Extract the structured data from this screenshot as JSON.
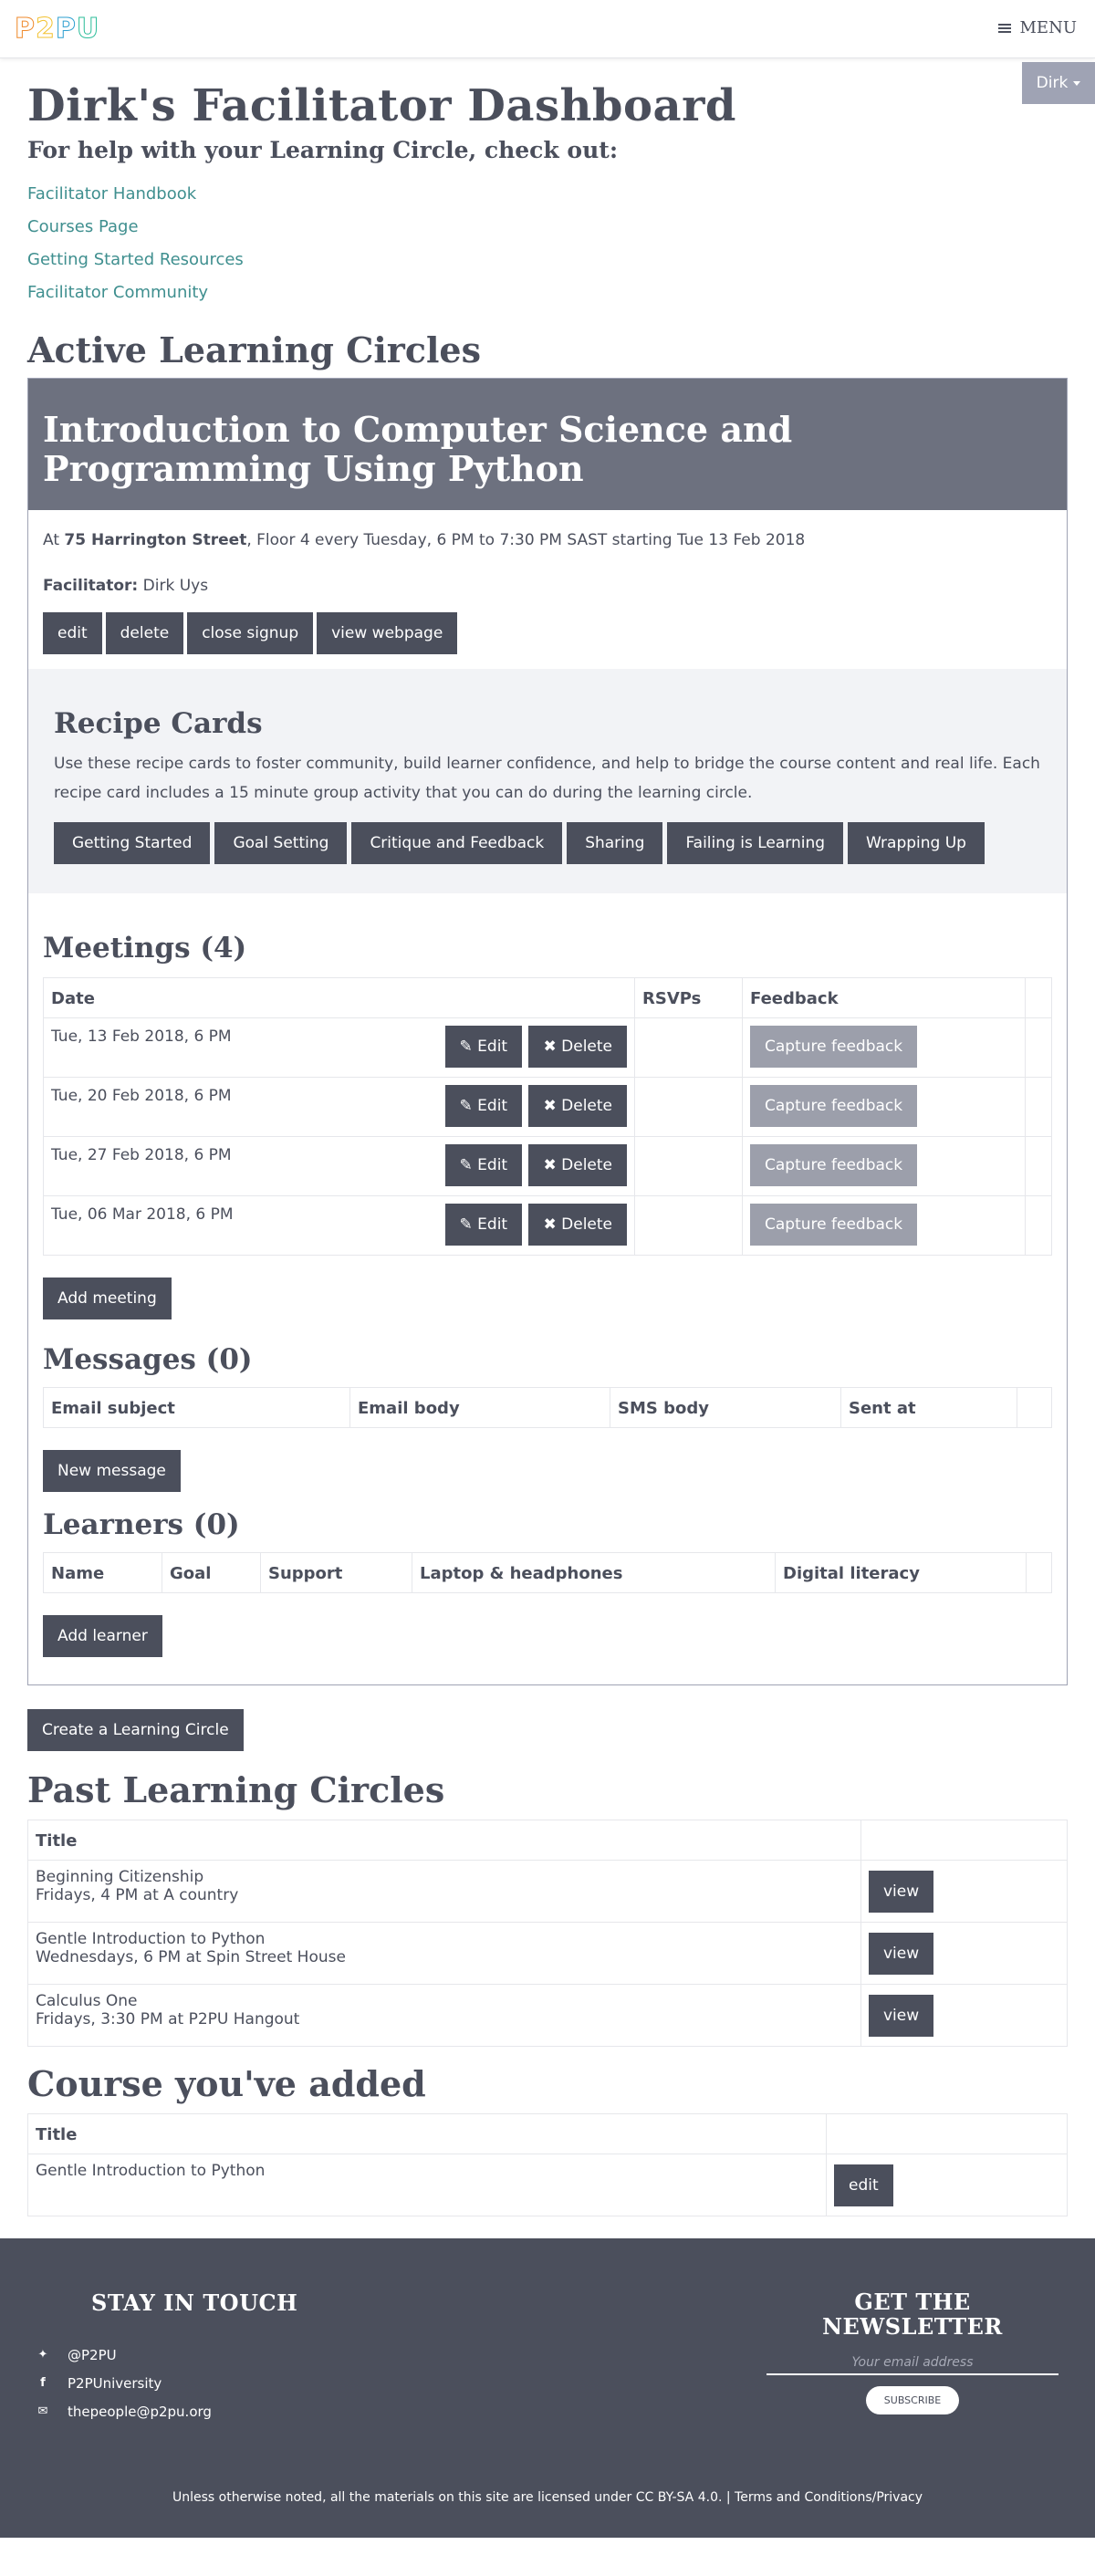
{
  "nav": {
    "logo": [
      "P",
      "2",
      "P",
      "U"
    ],
    "menu_label": "MENU",
    "user_label": "Dirk"
  },
  "page": {
    "title": "Dirk's Facilitator Dashboard",
    "help_heading": "For help with your Learning Circle, check out:",
    "help_links": [
      "Facilitator Handbook",
      "Courses Page",
      "Getting Started Resources",
      "Facilitator Community"
    ],
    "active_heading": "Active Learning Circles"
  },
  "circle": {
    "title": "Introduction to Computer Science and Programming Using Python",
    "at_prefix": "At ",
    "venue": "75 Harrington Street",
    "schedule": ", Floor 4 every Tuesday, 6 PM to 7:30 PM SAST starting Tue 13 Feb 2018",
    "facilitator_label": "Facilitator:",
    "facilitator_name": "Dirk Uys",
    "buttons": [
      "edit",
      "delete",
      "close signup",
      "view webpage"
    ]
  },
  "recipe": {
    "heading": "Recipe Cards",
    "description": "Use these recipe cards to foster community, build learner confidence, and help to bridge the course content and real life. Each recipe card includes a 15 minute group activity that you can do during the learning circle.",
    "cards": [
      "Getting Started",
      "Goal Setting",
      "Critique and Feedback",
      "Sharing",
      "Failing is Learning",
      "Wrapping Up"
    ]
  },
  "meetings": {
    "heading": "Meetings (4)",
    "columns": [
      "Date",
      "RSVPs",
      "Feedback"
    ],
    "rows": [
      {
        "date": "Tue, 13 Feb 2018, 6 PM"
      },
      {
        "date": "Tue, 20 Feb 2018, 6 PM"
      },
      {
        "date": "Tue, 27 Feb 2018, 6 PM"
      },
      {
        "date": "Tue, 06 Mar 2018, 6 PM"
      }
    ],
    "edit_label": "Edit",
    "delete_label": "Delete",
    "feedback_label": "Capture feedback",
    "add_label": "Add meeting"
  },
  "messages": {
    "heading": "Messages (0)",
    "columns": [
      "Email subject",
      "Email body",
      "SMS body",
      "Sent at"
    ],
    "new_label": "New message"
  },
  "learners": {
    "heading": "Learners (0)",
    "columns": [
      "Name",
      "Goal",
      "Support",
      "Laptop & headphones",
      "Digital literacy"
    ],
    "add_label": "Add learner"
  },
  "create_label": "Create a Learning Circle",
  "past": {
    "heading": "Past Learning Circles",
    "title_col": "Title",
    "rows": [
      {
        "title": "Beginning Citizenship",
        "detail": "Fridays, 4 PM at A country"
      },
      {
        "title": "Gentle Introduction to Python",
        "detail": "Wednesdays, 6 PM at Spin Street House"
      },
      {
        "title": "Calculus One",
        "detail": "Fridays, 3:30 PM at P2PU Hangout"
      }
    ],
    "view_label": "view"
  },
  "courses": {
    "heading": "Course you've added",
    "title_col": "Title",
    "rows": [
      {
        "title": "Gentle Introduction to Python"
      }
    ],
    "edit_label": "edit"
  },
  "footer": {
    "stay_heading": "STAY IN TOUCH",
    "twitter": "@P2PU",
    "facebook": "P2PUniversity",
    "email": "thepeople@p2pu.org",
    "newsletter_heading": "GET THE NEWSLETTER",
    "email_placeholder": "Your email address",
    "subscribe_label": "SUBSCRIBE",
    "license": "Unless otherwise noted, all the materials on this site are licensed under CC BY-SA 4.0. | Terms and Conditions/Privacy"
  }
}
